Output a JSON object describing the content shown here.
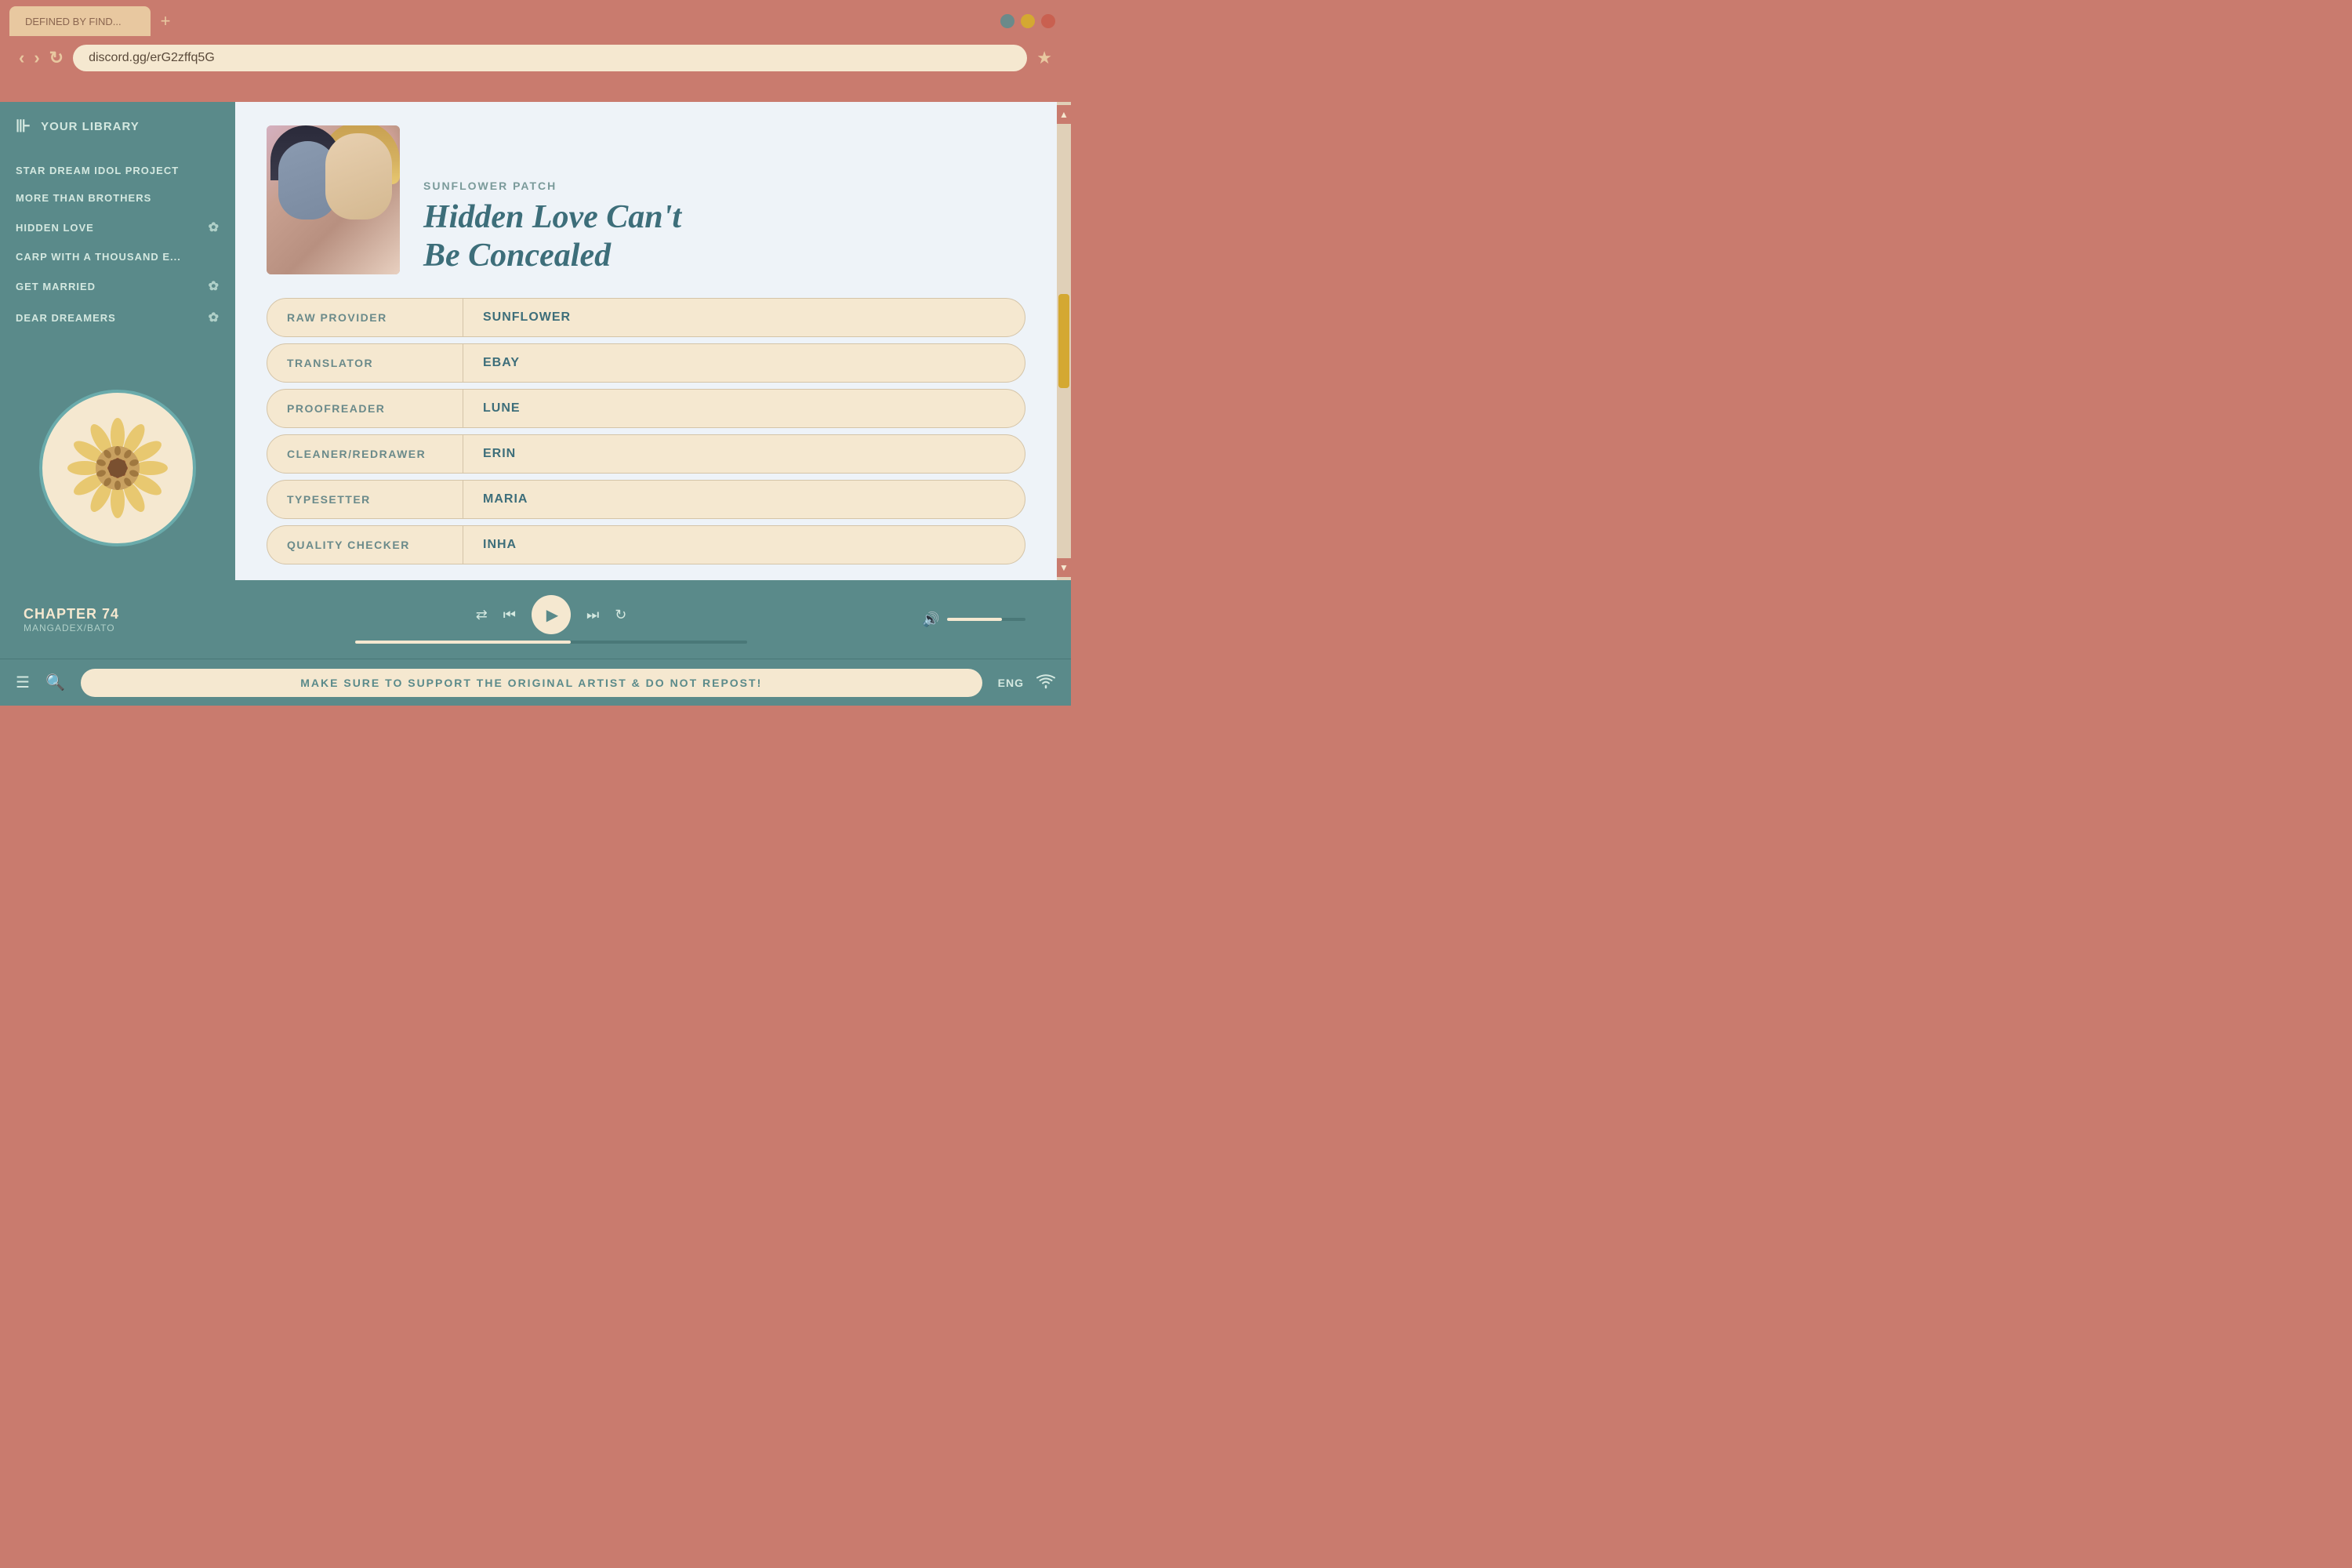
{
  "browser": {
    "tab_label": "DEFINED BY FIND...",
    "new_tab_icon": "+",
    "url": "discord.gg/erG2zffq5G",
    "back_icon": "‹",
    "forward_icon": "›",
    "reload_icon": "↻",
    "star_icon": "★",
    "window_controls": {
      "minimize": "●",
      "maximize": "●",
      "close": "●"
    }
  },
  "sidebar": {
    "library_label": "YOUR LIBRARY",
    "items": [
      {
        "label": "STAR DREAM IDOL PROJECT",
        "has_flower": false
      },
      {
        "label": "MORE THAN BROTHERS",
        "has_flower": false
      },
      {
        "label": "HIDDEN LOVE",
        "has_flower": true
      },
      {
        "label": "CARP WITH A THOUSAND E...",
        "has_flower": false
      },
      {
        "label": "GET MARRIED",
        "has_flower": true
      },
      {
        "label": "DEAR DREAMERS",
        "has_flower": true
      }
    ]
  },
  "manga": {
    "publisher": "SUNFLOWER PATCH",
    "title_line1": "Hidden Love Can't",
    "title_line2": "Be Concealed",
    "credits": [
      {
        "label": "RAW PROVIDER",
        "value": "SUNFLOWER"
      },
      {
        "label": "TRANSLATOR",
        "value": "EBAY"
      },
      {
        "label": "PROOFREADER",
        "value": "LUNE"
      },
      {
        "label": "CLEANER/REDRAWER",
        "value": "ERIN"
      },
      {
        "label": "TYPESETTER",
        "value": "MARIA"
      },
      {
        "label": "QUALITY CHECKER",
        "value": "INHA"
      }
    ]
  },
  "player": {
    "chapter": "CHAPTER 74",
    "source": "MANGADEX/BATO",
    "shuffle_icon": "⇄",
    "prev_icon": "⏮",
    "play_icon": "▶",
    "next_icon": "⏭",
    "repeat_icon": "↻",
    "volume_icon": "🔊"
  },
  "status_bar": {
    "menu_icon": "☰",
    "search_icon": "🔍",
    "message": "MAKE SURE TO SUPPORT THE ORIGINAL ARTIST & DO NOT REPOST!",
    "language": "ENG",
    "wifi_icon": "wifi"
  },
  "scrollbar": {
    "up_icon": "▲",
    "down_icon": "▼"
  },
  "colors": {
    "sidebar_bg": "#5a8a8a",
    "header_bg": "#c97b6e",
    "content_bg": "#eef3f8",
    "accent": "#d4a832",
    "text_teal": "#3d6e7a",
    "cream": "#f5e8d0"
  }
}
